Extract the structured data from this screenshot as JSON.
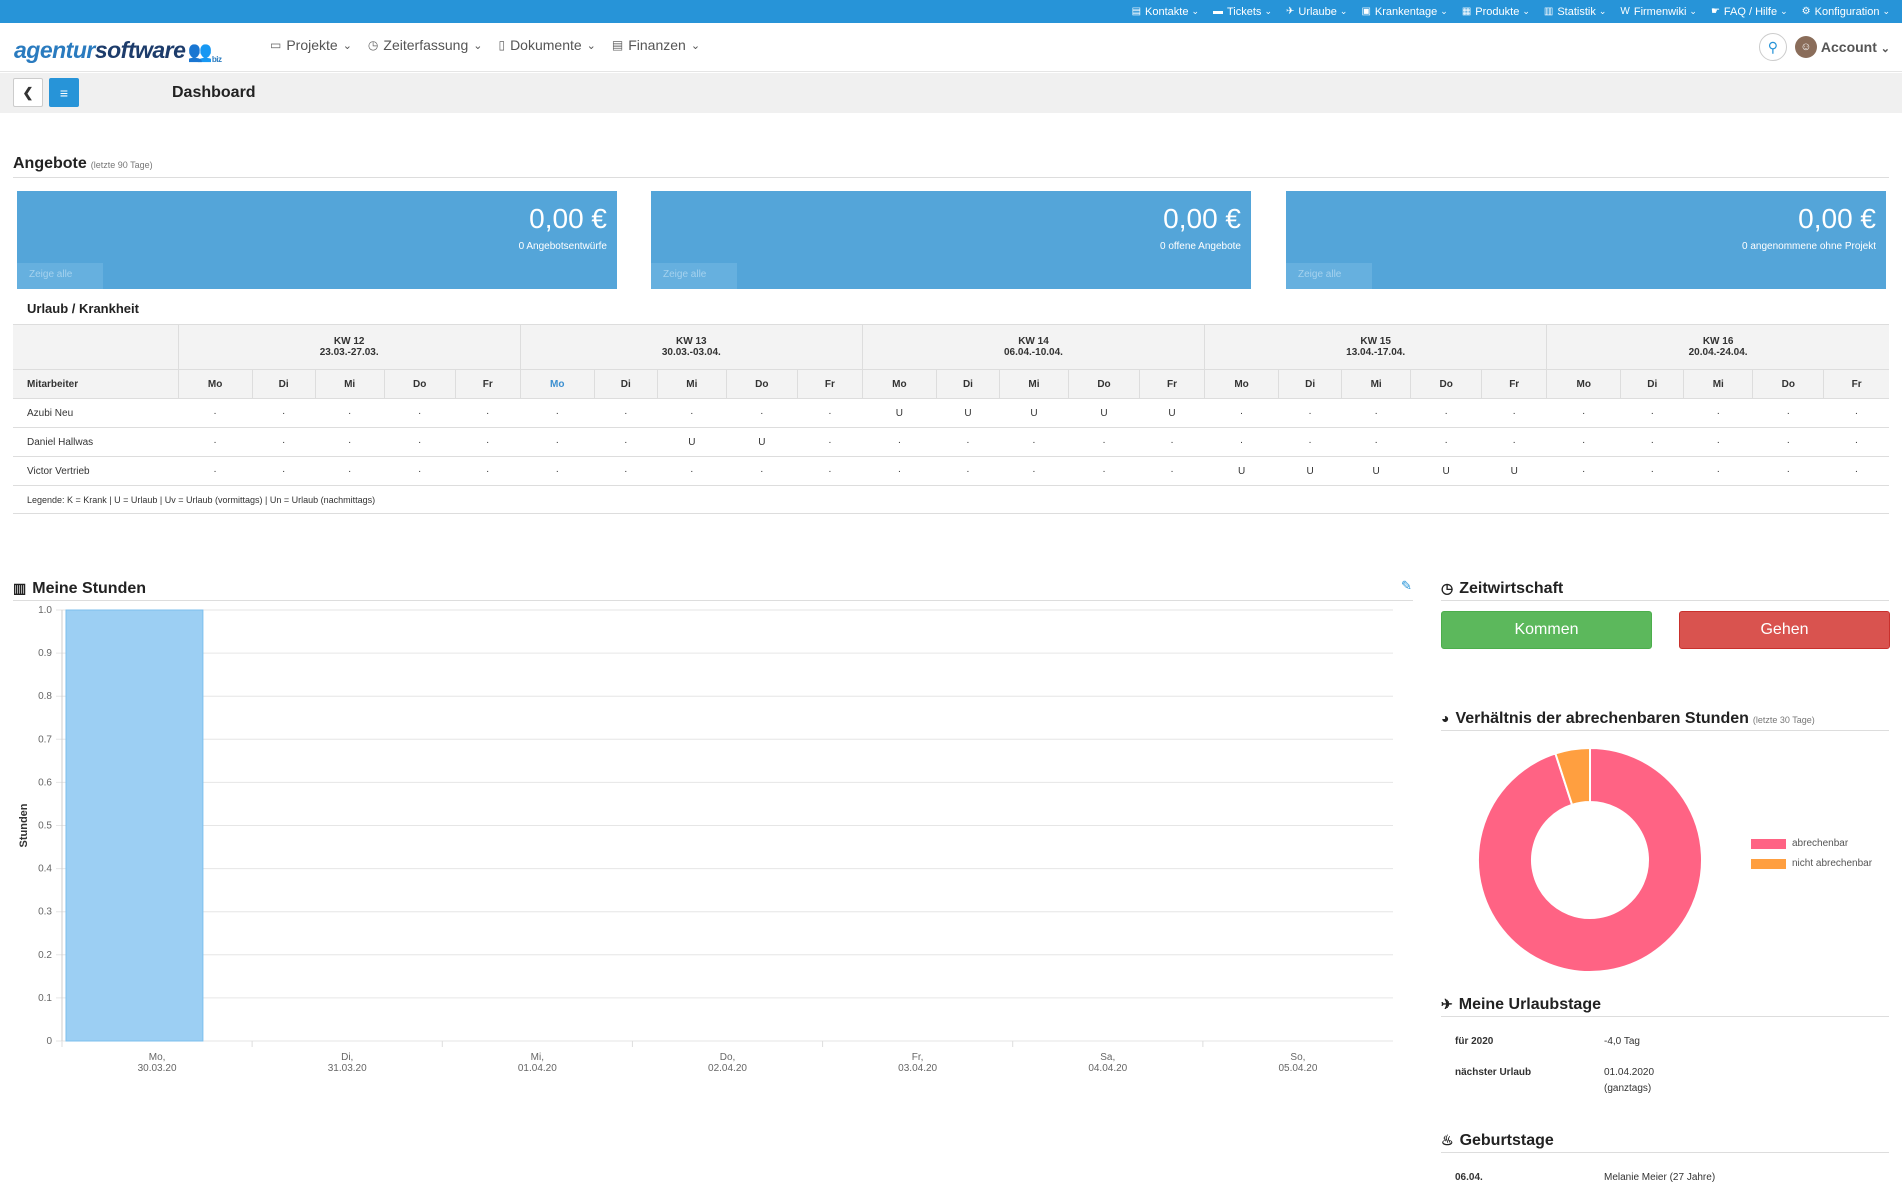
{
  "topnav": [
    {
      "label": "Kontakte",
      "icon": "address-book-icon",
      "glyph": "▤"
    },
    {
      "label": "Tickets",
      "icon": "ticket-icon",
      "glyph": "▬"
    },
    {
      "label": "Urlaube",
      "icon": "plane-icon",
      "glyph": "✈"
    },
    {
      "label": "Krankentage",
      "icon": "medkit-icon",
      "glyph": "▣"
    },
    {
      "label": "Produkte",
      "icon": "products-icon",
      "glyph": "▦"
    },
    {
      "label": "Statistik",
      "icon": "chart-icon",
      "glyph": "▥"
    },
    {
      "label": "Firmenwiki",
      "icon": "wiki-icon",
      "glyph": "W"
    },
    {
      "label": "FAQ / Hilfe",
      "icon": "help-icon",
      "glyph": "☛"
    },
    {
      "label": "Konfiguration",
      "icon": "cogs-icon",
      "glyph": "⚙"
    }
  ],
  "brand": {
    "part1": "agentur",
    "part2": "software",
    "suffix": "biz"
  },
  "mainnav": [
    {
      "label": "Projekte",
      "icon": "briefcase-icon",
      "glyph": "▭"
    },
    {
      "label": "Zeiterfassung",
      "icon": "clock-icon",
      "glyph": "◷"
    },
    {
      "label": "Dokumente",
      "icon": "file-icon",
      "glyph": "▯"
    },
    {
      "label": "Finanzen",
      "icon": "money-icon",
      "glyph": "▤"
    }
  ],
  "account_label": "Account",
  "page_title": "Dashboard",
  "angebote": {
    "title": "Angebote",
    "subtitle": "(letzte 90 Tage)",
    "tiles": [
      {
        "value": "0,00 €",
        "label": "0 Angebotsentwürfe",
        "more": "Zeige alle"
      },
      {
        "value": "0,00 €",
        "label": "0 offene Angebote",
        "more": "Zeige alle"
      },
      {
        "value": "0,00 €",
        "label": "0 angenommene ohne Projekt",
        "more": "Zeige alle"
      }
    ]
  },
  "urlaub": {
    "title": "Urlaub / Krankheit",
    "weeks": [
      {
        "kw": "KW 12",
        "range": "23.03.-27.03."
      },
      {
        "kw": "KW 13",
        "range": "30.03.-03.04."
      },
      {
        "kw": "KW 14",
        "range": "06.04.-10.04."
      },
      {
        "kw": "KW 15",
        "range": "13.04.-17.04."
      },
      {
        "kw": "KW 16",
        "range": "20.04.-24.04."
      }
    ],
    "days": [
      "Mo",
      "Di",
      "Mi",
      "Do",
      "Fr"
    ],
    "mitarbeiter_label": "Mitarbeiter",
    "highlight_day_index": 5,
    "rows": [
      {
        "name": "Azubi Neu",
        "cells": [
          "·",
          "·",
          "·",
          "·",
          "·",
          "·",
          "·",
          "·",
          "·",
          "·",
          "U",
          "U",
          "U",
          "U",
          "U",
          "·",
          "·",
          "·",
          "·",
          "·",
          "·",
          "·",
          "·",
          "·",
          "·"
        ]
      },
      {
        "name": "Daniel Hallwas",
        "cells": [
          "·",
          "·",
          "·",
          "·",
          "·",
          "·",
          "·",
          "U",
          "U",
          "·",
          "·",
          "·",
          "·",
          "·",
          "·",
          "·",
          "·",
          "·",
          "·",
          "·",
          "·",
          "·",
          "·",
          "·",
          "·"
        ]
      },
      {
        "name": "Victor Vertrieb",
        "cells": [
          "·",
          "·",
          "·",
          "·",
          "·",
          "·",
          "·",
          "·",
          "·",
          "·",
          "·",
          "·",
          "·",
          "·",
          "·",
          "U",
          "U",
          "U",
          "U",
          "U",
          "·",
          "·",
          "·",
          "·",
          "·"
        ]
      }
    ],
    "legend": "Legende: K = Krank | U = Urlaub | Uv = Urlaub (vormittags) | Un = Urlaub (nachmittags)"
  },
  "stunden": {
    "title": "Meine Stunden"
  },
  "chart_data": {
    "type": "bar",
    "categories": [
      [
        "Mo,",
        "30.03.20"
      ],
      [
        "Di,",
        "31.03.20"
      ],
      [
        "Mi,",
        "01.04.20"
      ],
      [
        "Do,",
        "02.04.20"
      ],
      [
        "Fr,",
        "03.04.20"
      ],
      [
        "Sa,",
        "04.04.20"
      ],
      [
        "So,",
        "05.04.20"
      ]
    ],
    "values": [
      1.0,
      0,
      0,
      0,
      0,
      0,
      0
    ],
    "ylabel": "Stunden",
    "ylim": [
      0,
      1.0
    ],
    "yticks": [
      "0",
      "0.1",
      "0.2",
      "0.3",
      "0.4",
      "0.5",
      "0.6",
      "0.7",
      "0.8",
      "0.9",
      "1.0"
    ],
    "grid": true,
    "color": "#9ccff3"
  },
  "zeitwirtschaft": {
    "title": "Zeitwirtschaft",
    "kommen": "Kommen",
    "gehen": "Gehen"
  },
  "verhaeltnis": {
    "title": "Verhältnis der abrechenbaren Stunden",
    "subtitle": "(letzte 30 Tage)",
    "slices": [
      {
        "label": "abrechenbar",
        "value": 95,
        "color": "#ff6384"
      },
      {
        "label": "nicht abrechenbar",
        "value": 5,
        "color": "#ff9f40"
      }
    ]
  },
  "urlaubstage": {
    "title": "Meine Urlaubstage",
    "rows": [
      {
        "key": "für 2020",
        "value": "-4,0 Tag",
        "value2": ""
      },
      {
        "key": "nächster Urlaub",
        "value": "01.04.2020",
        "value2": "(ganztags)"
      }
    ]
  },
  "geburtstage": {
    "title": "Geburtstage",
    "rows": [
      {
        "key": "06.04.",
        "value": "Melanie Meier (27 Jahre)"
      }
    ]
  }
}
